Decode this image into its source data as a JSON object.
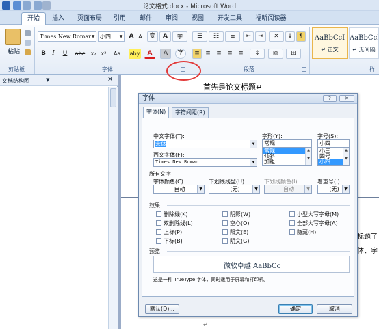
{
  "window": {
    "title": "论文格式.docx - Microsoft Word"
  },
  "tabs": [
    "开始",
    "插入",
    "页面布局",
    "引用",
    "邮件",
    "审阅",
    "视图",
    "开发工具",
    "福昕阅读器"
  ],
  "ribbon": {
    "clipboard": {
      "paste_label": "粘贴",
      "group_label": "剪贴板"
    },
    "font": {
      "font_name": "Times New Romar",
      "font_size": "小四",
      "group_label": "字体",
      "wen": "变",
      "grow": "A",
      "shrink": "A",
      "aa": "Aa",
      "bold": "B",
      "italic": "I",
      "underline": "U",
      "strike": "abc",
      "sub": "x₂",
      "sup": "x²",
      "clear": "A",
      "highlight": "aby",
      "color": "A",
      "charshade": "A",
      "circle": "字"
    },
    "paragraph": {
      "group_label": "段落"
    },
    "styles": {
      "items": [
        {
          "sample": "AaBbCcI",
          "name": "↵ 正文"
        },
        {
          "sample": "AaBbCcI",
          "name": "↵ 无间隔"
        }
      ],
      "group_label": "样式"
    }
  },
  "nav_pane": {
    "title": "文档结构图"
  },
  "document": {
    "heading": "首先是论文标题↵",
    "bg_text_1": "标题了",
    "bg_text_2": "体、字",
    "footer_mark": "↵"
  },
  "dialog": {
    "title": "字体",
    "help": "?",
    "close": "✕",
    "tabs": [
      "字体(N)",
      "字符间距(R)"
    ],
    "cn_font_label": "中文字体(T):",
    "cn_font_value": "宋体",
    "western_font_label": "西文字体(F):",
    "western_font_value": "Times New Roman",
    "style_label": "字形(Y):",
    "style_value": "常规",
    "style_options": [
      "常规",
      "倾斜",
      "加粗"
    ],
    "size_label": "字号(S):",
    "size_value": "小四",
    "size_options": [
      "小三",
      "四号",
      "小四"
    ],
    "all_text_label": "所有文字",
    "font_color_label": "字体颜色(C):",
    "font_color_value": "自动",
    "underline_label": "下划线线型(U):",
    "underline_value": "(无)",
    "underline_color_label": "下划线颜色(I):",
    "underline_color_value": "自动",
    "emphasis_label": "着重号(·):",
    "emphasis_value": "(无)",
    "effects_label": "效果",
    "effects": [
      "删除线(K)",
      "阴影(W)",
      "小型大写字母(M)",
      "双删除线(L)",
      "空心(O)",
      "全部大写字母(A)",
      "上标(P)",
      "阳文(E)",
      "隐藏(H)",
      "下标(B)",
      "阴文(G)"
    ],
    "preview_label": "预览",
    "preview_text": "微软卓越 AaBbCc",
    "note": "这是一种 TrueType 字体，同时适用于屏幕和打印机。",
    "default_btn": "默认(D)...",
    "ok_btn": "确定",
    "cancel_btn": "取消"
  },
  "annotation_color": "#e23a3a"
}
